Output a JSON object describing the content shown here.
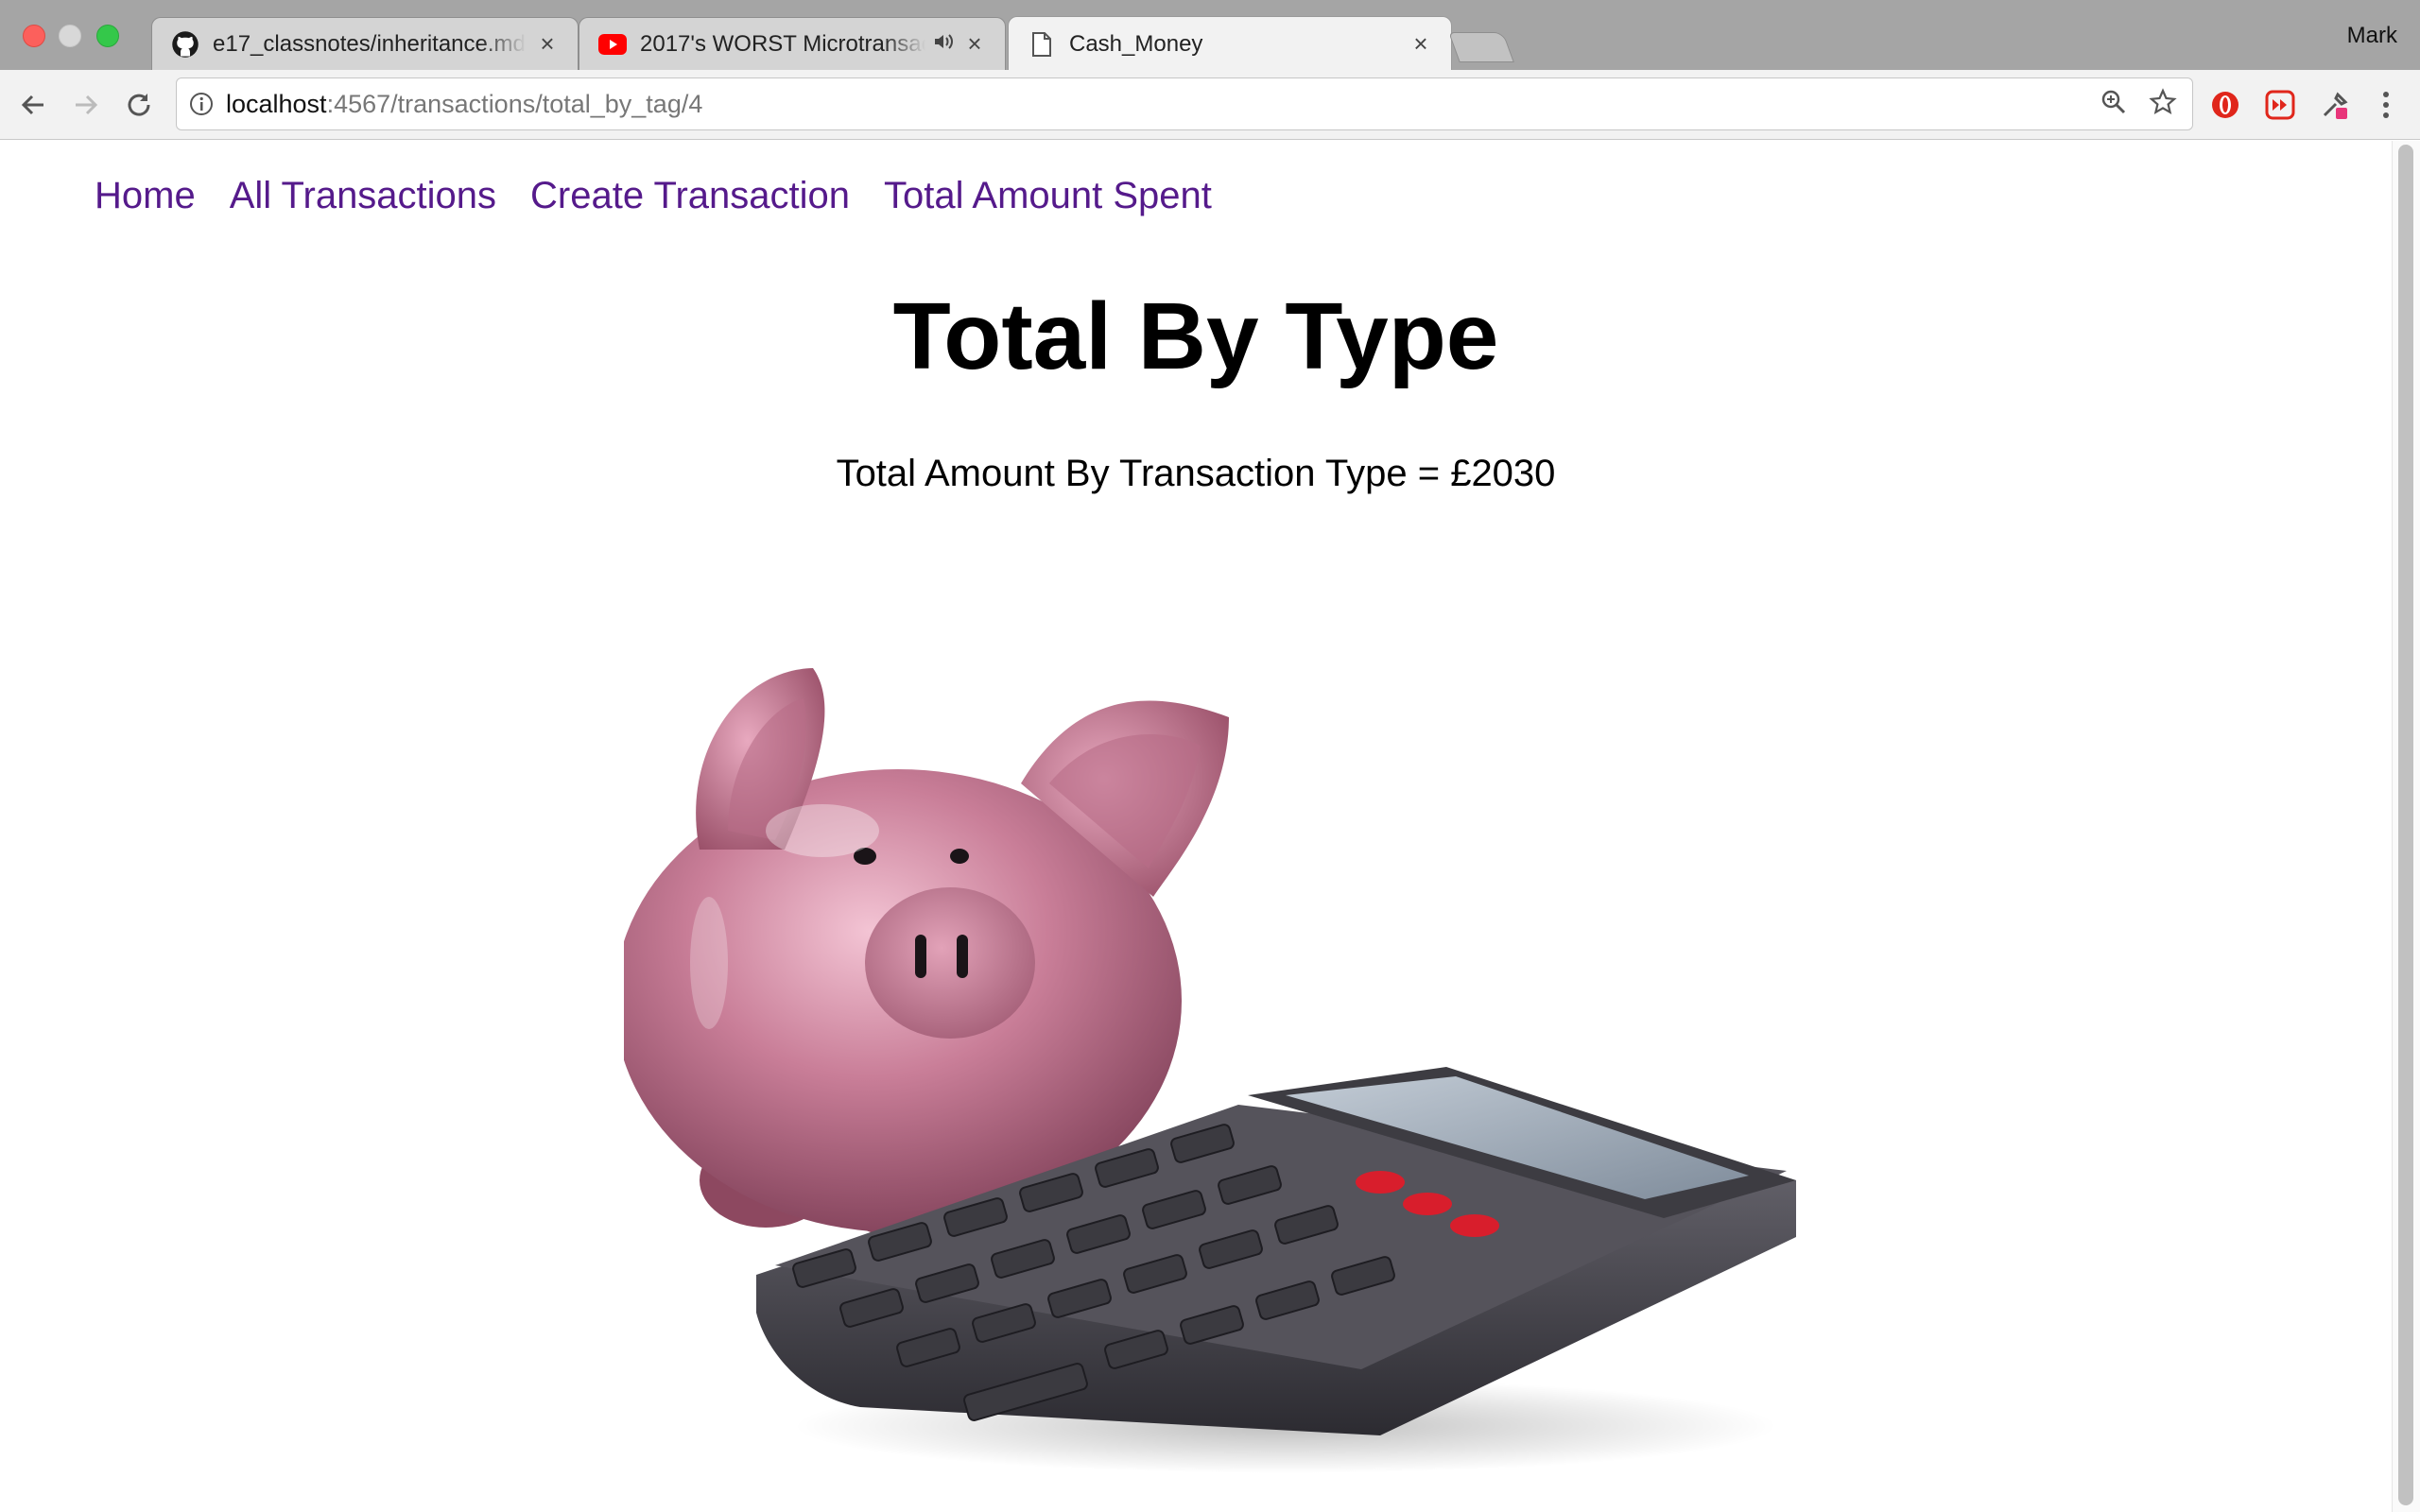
{
  "browser": {
    "tabs": [
      {
        "title": "e17_classnotes/inheritance.md",
        "favicon": "github-icon"
      },
      {
        "title": "2017's WORST Microtransactions",
        "favicon": "youtube-icon",
        "audio": true
      },
      {
        "title": "Cash_Money",
        "favicon": "page-icon",
        "active": true
      }
    ],
    "profile": "Mark",
    "url_host": "localhost",
    "url_path": ":4567/transactions/total_by_tag/4"
  },
  "nav": {
    "links": [
      "Home",
      "All Transactions",
      "Create Transaction",
      "Total Amount Spent"
    ]
  },
  "page": {
    "title": "Total By Type",
    "total_text": "Total Amount By Transaction Type = £2030",
    "image": "piggy-bank-calculator"
  },
  "colors": {
    "link": "#551a8b",
    "pig": "#c47b93",
    "calculator": "#4a4a52"
  }
}
